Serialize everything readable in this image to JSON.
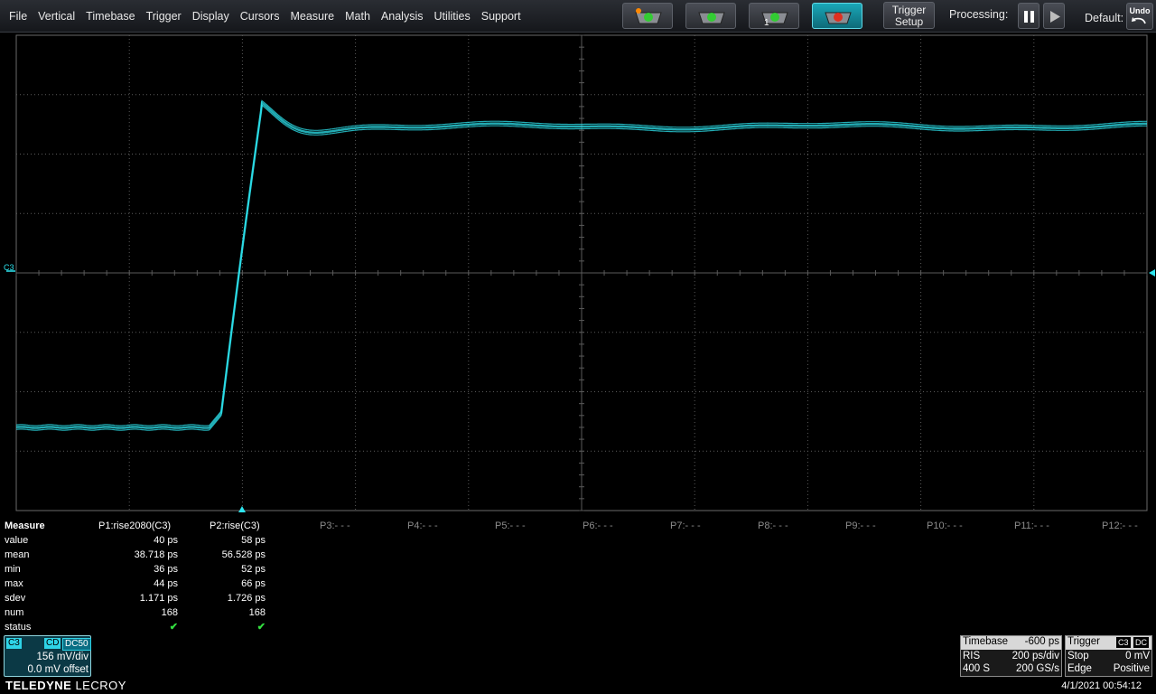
{
  "menu": [
    "File",
    "Vertical",
    "Timebase",
    "Trigger",
    "Display",
    "Cursors",
    "Measure",
    "Math",
    "Analysis",
    "Utilities",
    "Support"
  ],
  "toolbar": {
    "trigger_setup": [
      "Trigger",
      "Setup"
    ],
    "processing_label": "Processing:",
    "default_label": "Default:",
    "undo_label": "Undo"
  },
  "channel_marker": "C3",
  "measure": {
    "header": "Measure",
    "row_labels": [
      "value",
      "mean",
      "min",
      "max",
      "sdev",
      "num",
      "status"
    ],
    "params": [
      {
        "name": "P1:rise2080(C3)",
        "values": [
          "40 ps",
          "38.718 ps",
          "36 ps",
          "44 ps",
          "1.171 ps",
          "168",
          "✔"
        ]
      },
      {
        "name": "P2:rise(C3)",
        "values": [
          "58 ps",
          "56.528 ps",
          "52 ps",
          "66 ps",
          "1.726 ps",
          "168",
          "✔"
        ]
      }
    ],
    "empty_params": [
      "P3:- - -",
      "P4:- - -",
      "P5:- - -",
      "P6:- - -",
      "P7:- - -",
      "P8:- - -",
      "P9:- - -",
      "P10:- - -",
      "P11:- - -",
      "P12:- - -"
    ]
  },
  "channel": {
    "name": "C3",
    "coupling": "CD",
    "dc": "DC50",
    "vdiv": "156 mV/div",
    "offset": "0.0 mV offset"
  },
  "timebase": {
    "label": "Timebase",
    "delay": "-600 ps",
    "mode": "RIS",
    "tdiv": "200 ps/div",
    "samples": "400 S",
    "rate": "200 GS/s"
  },
  "trigger": {
    "label": "Trigger",
    "channel": "C3",
    "coupling": "DC",
    "mode": "Stop",
    "level": "0 mV",
    "type": "Edge",
    "slope": "Positive"
  },
  "brand": {
    "bold": "TELEDYNE",
    "normal": " LECROY"
  },
  "datetime": "4/1/2021 00:54:12",
  "colors": {
    "trace": "#2ee6f0",
    "grid": "#5a5a5a",
    "accent": "#2ed3e6"
  }
}
